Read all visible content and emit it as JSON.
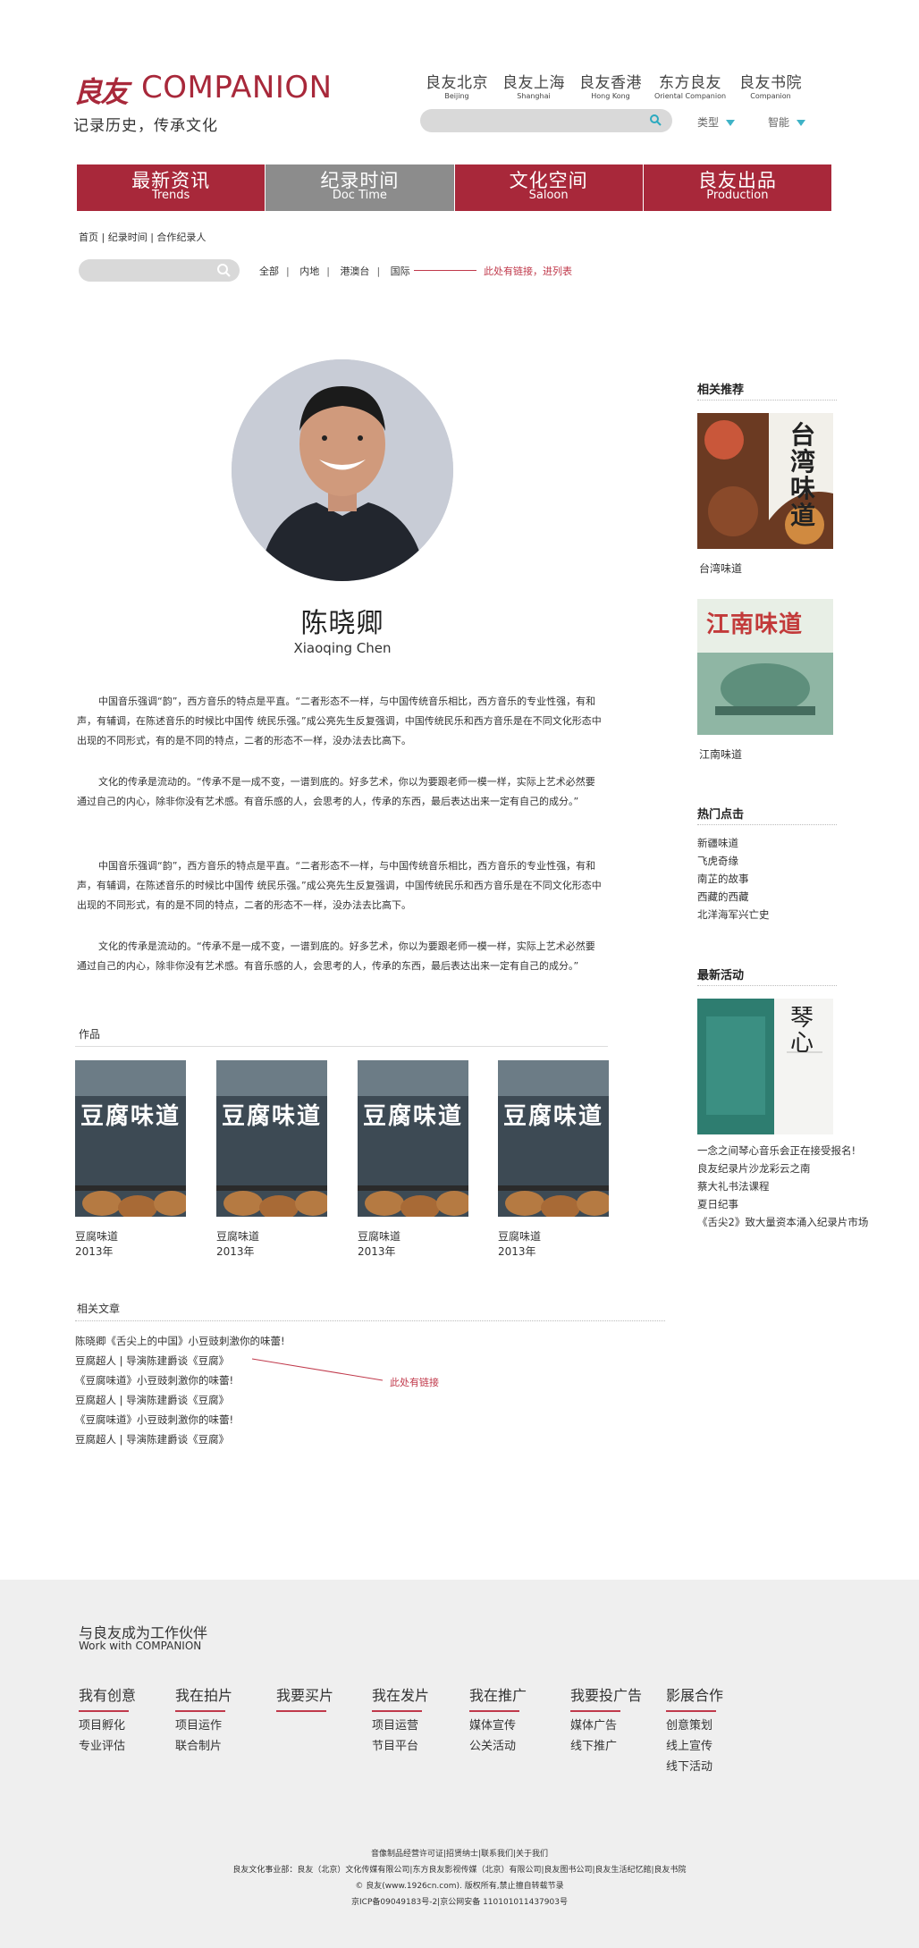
{
  "header": {
    "logo_cn": "良友",
    "logo_en": "COMPANION",
    "slogan": "记录历史，传承文化",
    "branches": [
      {
        "cn": "良友北京",
        "en": "Beijing"
      },
      {
        "cn": "良友上海",
        "en": "Shanghai"
      },
      {
        "cn": "良友香港",
        "en": "Hong Kong"
      },
      {
        "cn": "东方良友",
        "en": "Oriental Companion"
      },
      {
        "cn": "良友书院",
        "en": "Companion"
      }
    ],
    "dropdowns": [
      "类型",
      "智能"
    ]
  },
  "nav": [
    {
      "cn": "最新资讯",
      "en": "Trends"
    },
    {
      "cn": "纪录时间",
      "en": "Doc Time",
      "active": true
    },
    {
      "cn": "文化空间",
      "en": "Saloon"
    },
    {
      "cn": "良友出品",
      "en": "Production"
    }
  ],
  "breadcrumb": "首页 | 纪录时间 | 合作纪录人",
  "filters": [
    "全部",
    "内地",
    "港澳台",
    "国际"
  ],
  "note_link_list": "此处有链接，进列表",
  "person": {
    "name_cn": "陈晓卿",
    "name_en": "Xiaoqing Chen"
  },
  "paragraphs": [
    "中国音乐强调“韵”，西方音乐的特点是平直。“二者形态不一样，与中国传统音乐相比，西方音乐的专业性强，有和声，有辅调，在陈述音乐的时候比中国传 统民乐强。”成公亮先生反复强调，中国传统民乐和西方音乐是在不同文化形态中出现的不同形式，有的是不同的特点，二者的形态不一样，没办法去比高下。",
    "文化的传承是流动的。“传承不是一成不变，一谱到底的。好多艺术，你以为要跟老师一模一样，实际上艺术必然要通过自己的内心，除非你没有艺术感。有音乐感的人，会思考的人，传承的东西，最后表达出来一定有自己的成分。”",
    "中国音乐强调“韵”，西方音乐的特点是平直。“二者形态不一样，与中国传统音乐相比，西方音乐的专业性强，有和声，有辅调，在陈述音乐的时候比中国传 统民乐强。”成公亮先生反复强调，中国传统民乐和西方音乐是在不同文化形态中出现的不同形式，有的是不同的特点，二者的形态不一样，没办法去比高下。",
    "文化的传承是流动的。“传承不是一成不变，一谱到底的。好多艺术，你以为要跟老师一模一样，实际上艺术必然要通过自己的内心，除非你没有艺术感。有音乐感的人，会思考的人，传承的东西，最后表达出来一定有自己的成分。”"
  ],
  "works_title": "作品",
  "works": [
    {
      "cover_text": "豆腐味道",
      "title": "豆腐味道",
      "year": "2013年"
    },
    {
      "cover_text": "豆腐味道",
      "title": "豆腐味道",
      "year": "2013年"
    },
    {
      "cover_text": "豆腐味道",
      "title": "豆腐味道",
      "year": "2013年"
    },
    {
      "cover_text": "豆腐味道",
      "title": "豆腐味道",
      "year": "2013年"
    }
  ],
  "related_title": "相关文章",
  "related": [
    "陈晓卿《舌尖上的中国》小豆豉刺激你的味蕾!",
    "豆腐超人 | 导演陈建爵谈《豆腐》",
    "《豆腐味道》小豆豉刺激你的味蕾!",
    "豆腐超人 | 导演陈建爵谈《豆腐》",
    "《豆腐味道》小豆豉刺激你的味蕾!",
    "豆腐超人 | 导演陈建爵谈《豆腐》"
  ],
  "note_link": "此处有链接",
  "sidebar": {
    "recommend_title": "相关推荐",
    "recommend": [
      {
        "cover_text": "台湾味道",
        "caption": "台湾味道"
      },
      {
        "cover_text": "江南味道",
        "caption": "江南味道"
      }
    ],
    "hot_title": "热门点击",
    "hot": [
      "新疆味道",
      "飞虎奇缘",
      "南芷的故事",
      "西藏的西藏",
      "北洋海军兴亡史"
    ],
    "events_title": "最新活动",
    "event_cover_text": "琴心",
    "events": [
      "一念之间琴心音乐会正在接受报名!",
      "良友纪录片沙龙彩云之南",
      "蔡大礼书法课程",
      "夏日纪事",
      "《舌尖2》致大量资本涌入纪录片市场"
    ]
  },
  "footer": {
    "partner_cn": "与良友成为工作伙伴",
    "partner_en": "Work with COMPANION",
    "columns": [
      {
        "title": "我有创意",
        "links": [
          "项目孵化",
          "专业评估"
        ]
      },
      {
        "title": "我在拍片",
        "links": [
          "项目运作",
          "联合制片"
        ]
      },
      {
        "title": "我要买片",
        "links": []
      },
      {
        "title": "我在发片",
        "links": [
          "项目运营",
          "节目平台"
        ]
      },
      {
        "title": "我在推广",
        "links": [
          "媒体宣传",
          "公关活动"
        ]
      },
      {
        "title": "我要投广告",
        "links": [
          "媒体广告",
          "线下推广"
        ]
      },
      {
        "title": "影展合作",
        "links": [
          "创意策划",
          "线上宣传",
          "线下活动"
        ]
      }
    ],
    "copyright": [
      "音像制品经营许可证|招贤纳士|联系我们|关于我们",
      "良友文化事业部：良友（北京）文化传媒有限公司|东方良友影视传媒（北京）有限公司|良友图书公司|良友生活纪忆館|良友书院",
      "© 良友(www.1926cn.com). 版权所有,禁止擅自转载节录",
      "京ICP备09049183号-2|京公网安备 110101011437903号"
    ]
  },
  "colors": {
    "brand": "#a8283a",
    "nav_active": "#8c8c8c",
    "accent": "#3fb3c7",
    "footer_bg": "#efefef"
  }
}
